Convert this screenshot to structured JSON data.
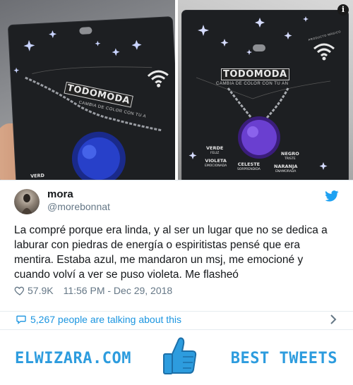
{
  "photos": {
    "left": {
      "brand_label": "TODOMODA",
      "sub_label": "CAMBIA DE COLOR CON TU A",
      "mood_visible": "VERD"
    },
    "right": {
      "brand_label": "TODOMODA",
      "sub_label": "CAMBIA DE COLOR CON TU AN",
      "corner_badge": "PRODUCTO MÁGICO",
      "moods": [
        {
          "label": "VERDE",
          "sub": "FELIZ"
        },
        {
          "label": "NEGRO",
          "sub": "TRISTE"
        },
        {
          "label": "VIOLETA",
          "sub": "EMOCIONADA"
        },
        {
          "label": "CELESTE",
          "sub": "SORPRENDIDA"
        },
        {
          "label": "NARANJA",
          "sub": "ENAMORADA"
        }
      ]
    },
    "info_badge": "i"
  },
  "tweet": {
    "display_name": "mora",
    "handle": "@morebonnat",
    "text": "La compré porque era linda, y al ser un lugar que no se dedica a laburar con piedras de energía o espiritistas pensé que era mentira. Estaba azul, me mandaron un msj, me emocioné y cuando volví a ver se puso violeta. Me flasheó",
    "likes": "57.9K",
    "timestamp": "11:56 PM - Dec 29, 2018"
  },
  "talking": {
    "text": "5,267 people are talking about this"
  },
  "footer": {
    "brand": "ELWIZARA.COM",
    "tagline": "BEST TWEETS"
  },
  "colors": {
    "twitter_blue": "#1da1f2",
    "link_blue": "#1b95e0",
    "brand_blue": "#2d9cde",
    "muted": "#657786"
  }
}
